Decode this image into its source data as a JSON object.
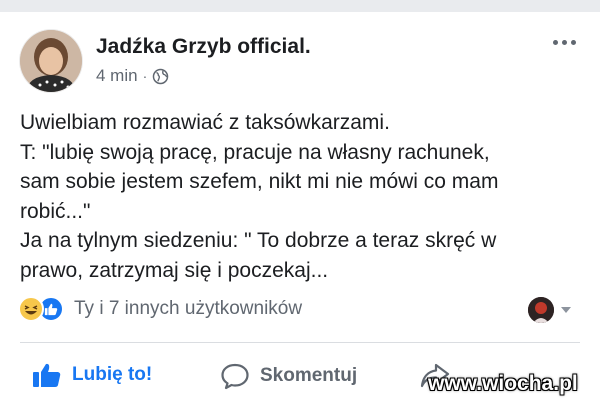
{
  "post": {
    "author": "Jadźka Grzyb official.",
    "time": "4 min",
    "separator": "·",
    "lines": [
      "Uwielbiam rozmawiać z taksówkarzami.",
      "T: \"lubię swoją pracę, pracuje na własny rachunek,",
      "sam sobie jestem szefem, nikt mi nie mówi co mam",
      "robić...\"",
      "Ja na tylnym siedzeniu: \" To dobrze a teraz skręć w",
      "prawo, zatrzymaj się i poczekaj..."
    ]
  },
  "reactions": {
    "text": "Ty i 7 innych użytkowników",
    "icons": [
      "haha-icon",
      "like-icon"
    ]
  },
  "actions": {
    "like": "Lubię to!",
    "comment": "Skomentuj"
  },
  "watermark": "www.wiocha.pl",
  "colors": {
    "brand_blue": "#1877f2",
    "text": "#1c1e21",
    "secondary": "#606770",
    "divider": "#dadde1",
    "background_band": "#e9ebee"
  }
}
